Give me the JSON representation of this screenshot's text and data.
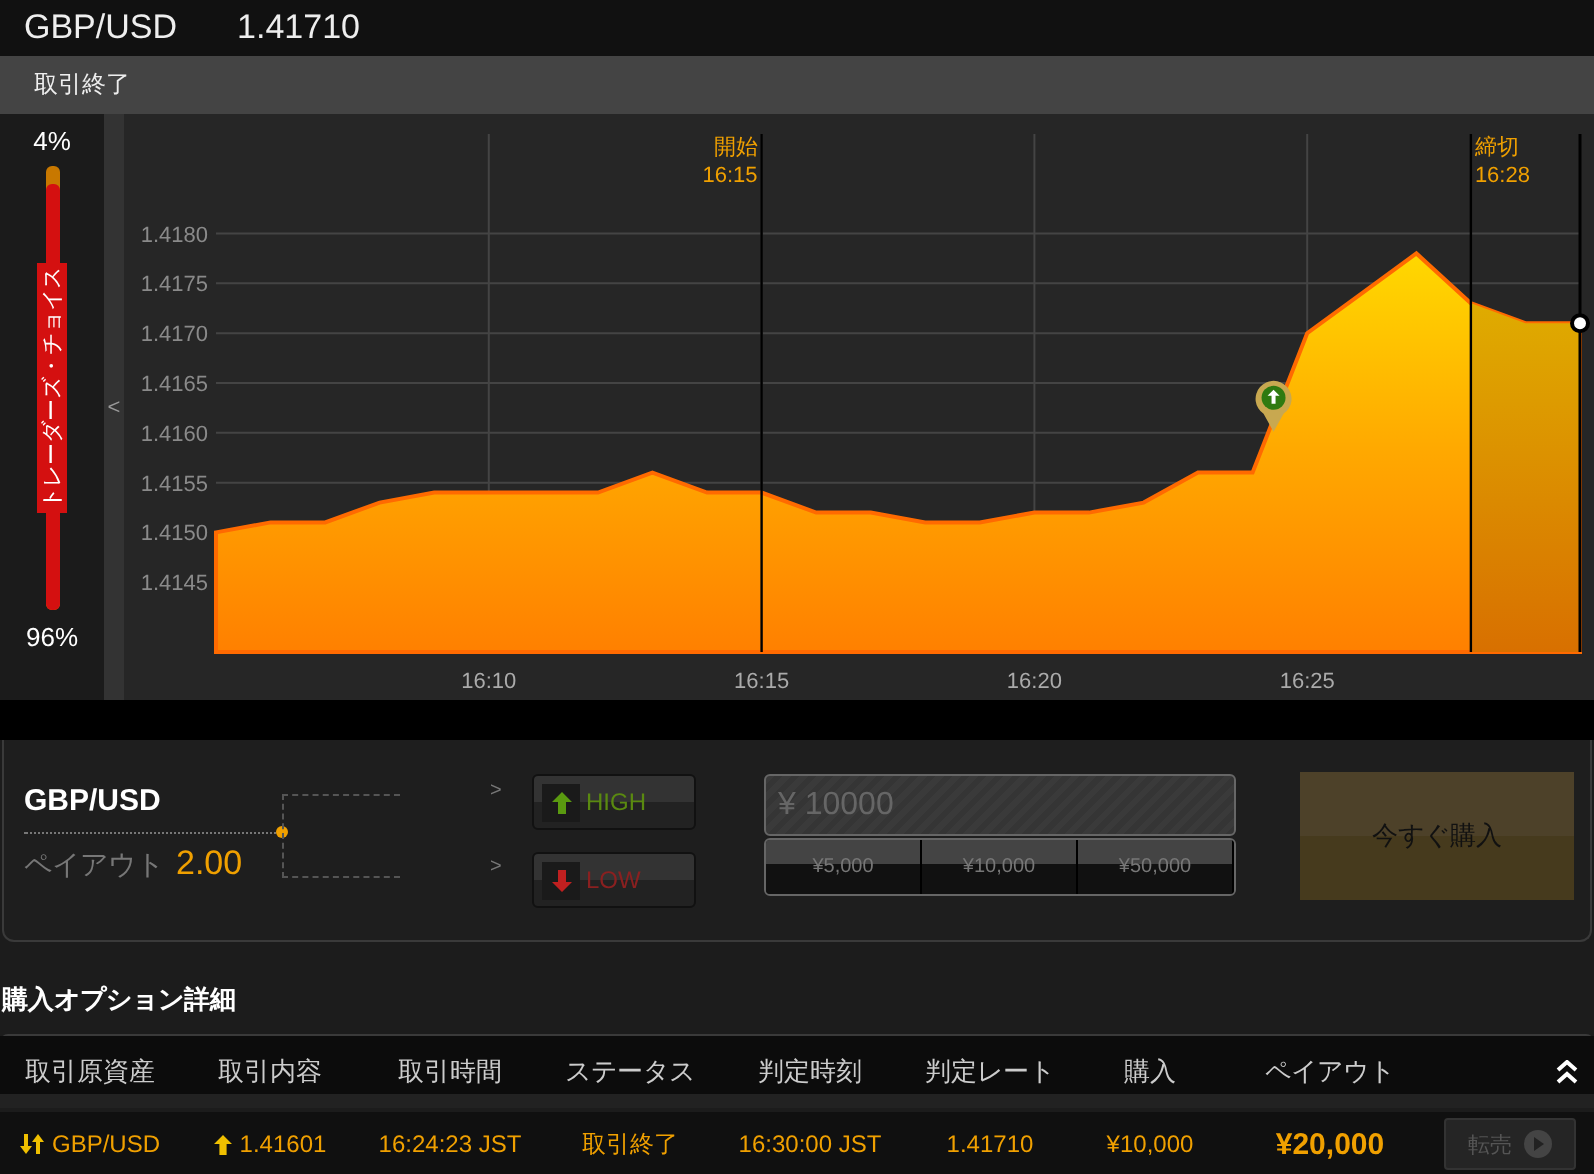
{
  "header": {
    "symbol": "GBP/USD",
    "price": "1.41710"
  },
  "status_bar": {
    "text": "取引終了"
  },
  "trader_choice": {
    "title": "トレーダーズ・チョイス",
    "high_label": "4%",
    "low_label": "96%",
    "level": 0.96
  },
  "collapse_arrow": "<",
  "chart_markers": [
    {
      "kind": "start",
      "label": "開始",
      "time": "16:15"
    },
    {
      "kind": "deadline",
      "label": "締切",
      "time": "16:28"
    }
  ],
  "chart_data": {
    "type": "area",
    "grid": true,
    "categories": [
      null,
      null,
      null,
      null,
      null,
      "16:10",
      null,
      null,
      null,
      null,
      "16:15",
      null,
      null,
      null,
      null,
      "16:20",
      null,
      null,
      null,
      null,
      "16:25",
      null,
      null,
      null,
      null,
      null
    ],
    "series": [
      {
        "color": "#ff6a00",
        "values": [
          1.415,
          1.4151,
          1.4151,
          1.4153,
          1.4154,
          1.4154,
          1.4154,
          1.4154,
          1.4156,
          1.4154,
          1.4154,
          1.4152,
          1.4152,
          1.4151,
          1.4151,
          1.4152,
          1.4152,
          1.4153,
          1.4156,
          1.4156,
          1.417,
          1.4174,
          1.4178,
          1.4173,
          1.4171,
          1.4171
        ]
      }
    ],
    "ylim": [
      1.4138,
      1.4192
    ],
    "yticks": [
      {
        "value": 1.4145,
        "label": "1.4145"
      },
      {
        "value": 1.415,
        "label": "1.4150"
      },
      {
        "value": 1.4155,
        "label": "1.4155"
      },
      {
        "value": 1.416,
        "label": "1.4160"
      },
      {
        "value": 1.4165,
        "label": "1.4165"
      },
      {
        "value": 1.417,
        "label": "1.4170"
      },
      {
        "value": 1.4175,
        "label": "1.4175"
      },
      {
        "value": 1.418,
        "label": "1.4180"
      }
    ]
  },
  "option": {
    "asset": "GBP/USD",
    "payout_label": "ペイアウト",
    "payout": "2.00",
    "chevrons": [
      ">",
      ">"
    ],
    "directions": [
      {
        "kind": "high",
        "label": "HIGH"
      },
      {
        "kind": "low",
        "label": "LOW"
      }
    ],
    "amount": {
      "placeholder": "¥ 10000"
    },
    "presets": [
      "¥5,000",
      "¥10,000",
      "¥50,000"
    ],
    "buy_button": {
      "label": "今すぐ購入",
      "disabled": true
    }
  },
  "details": {
    "title": "購入オプション詳細",
    "columns": [
      "取引原資産",
      "取引内容",
      "取引時間",
      "ステータス",
      "判定時刻",
      "判定レート",
      "購入",
      "ペイアウト"
    ],
    "rows": [
      {
        "asset": "GBP/USD",
        "up": true,
        "rate": "1.41601",
        "time": "16:24:23 JST",
        "status": "取引終了",
        "judge_time": "16:30:00 JST",
        "judge_rate": "1.41710",
        "purchase": "¥10,000",
        "payout": "¥20,000",
        "resell": {
          "label": "転売",
          "disabled": true
        }
      }
    ]
  }
}
